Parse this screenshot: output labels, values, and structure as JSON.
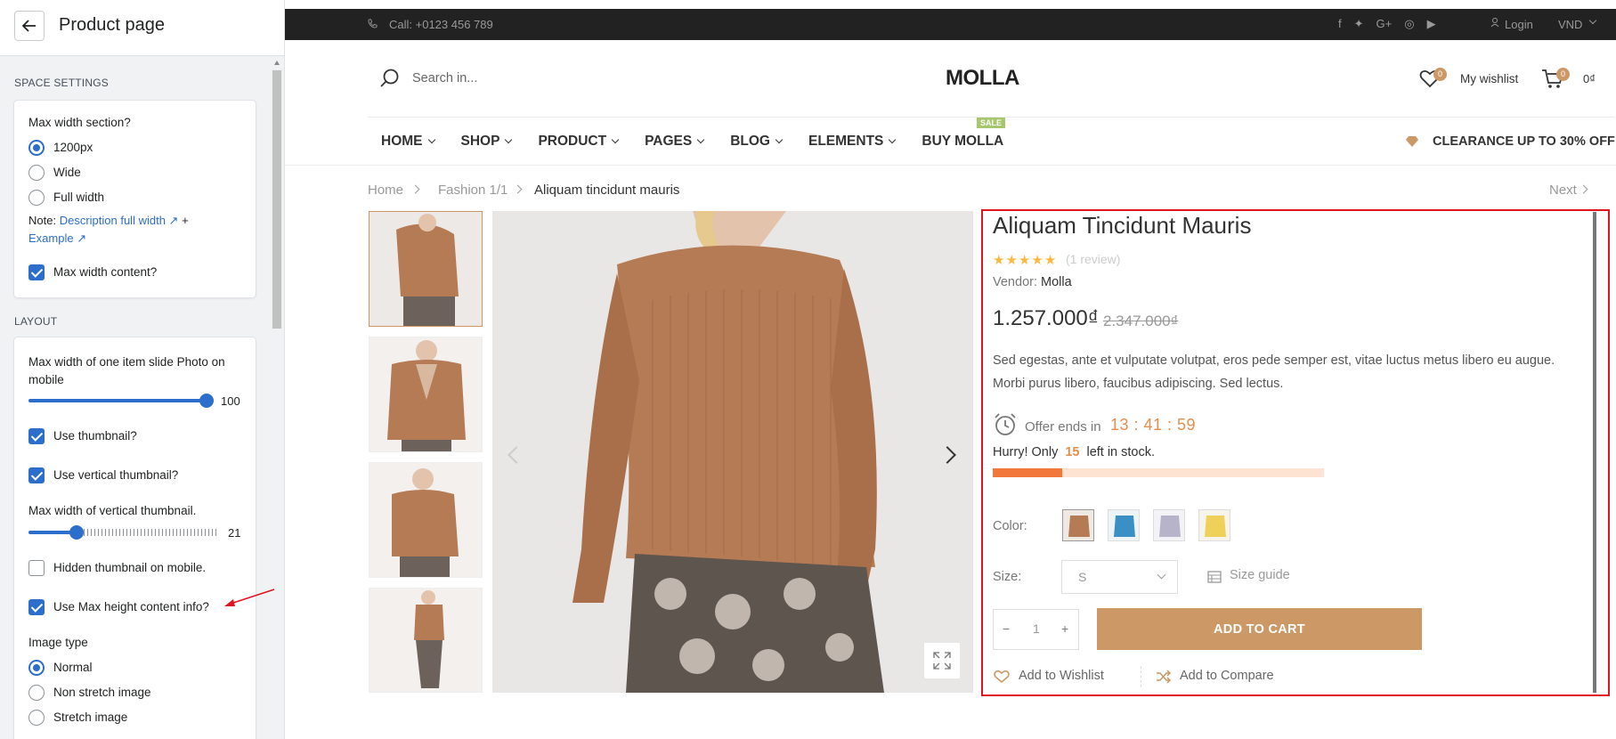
{
  "editor": {
    "title": "Product page",
    "space_settings": {
      "section_title": "SPACE SETTINGS",
      "max_width_label": "Max width section?",
      "options": [
        "1200px",
        "Wide",
        "Full width"
      ],
      "selected": "1200px",
      "note_prefix": "Note:",
      "note_link": "Description full width",
      "note_plus": "+",
      "example_link": "Example",
      "max_width_content_label": "Max width content?",
      "max_width_content_checked": true
    },
    "layout": {
      "section_title": "LAYOUT",
      "slide_label": "Max width of one item slide Photo on mobile",
      "slide_value": "100",
      "use_thumbnail_label": "Use thumbnail?",
      "use_thumbnail_checked": true,
      "use_vertical_label": "Use vertical thumbnail?",
      "use_vertical_checked": true,
      "vertical_width_label": "Max width of vertical thumbnail.",
      "vertical_width_value": "21",
      "hidden_mobile_label": "Hidden thumbnail on mobile.",
      "hidden_mobile_checked": false,
      "max_height_label": "Use Max height content info?",
      "max_height_checked": true,
      "image_type_label": "Image type",
      "image_types": [
        "Normal",
        "Non stretch image",
        "Stretch image"
      ],
      "image_type_selected": "Normal"
    }
  },
  "store": {
    "topbar": {
      "phone": "Call: +0123 456 789",
      "login": "Login",
      "currency": "VND"
    },
    "search_placeholder": "Search in...",
    "logo": "MOLLA",
    "wishlist_count": "0",
    "wishlist_label": "My wishlist",
    "cart_count": "0",
    "cart_total": "0₫",
    "nav": [
      "HOME",
      "SHOP",
      "PRODUCT",
      "PAGES",
      "BLOG",
      "ELEMENTS",
      "BUY MOLLA"
    ],
    "sale_tag": "SALE",
    "clearance": "CLEARANCE UP TO 30% OFF",
    "breadcrumb": [
      "Home",
      "Fashion 1/1",
      "Aliquam tincidunt mauris"
    ],
    "next_label": "Next",
    "product": {
      "title": "Aliquam Tincidunt Mauris",
      "rating": 5,
      "reviews": "(1 review)",
      "vendor_label": "Vendor:",
      "vendor": "Molla",
      "price": "1.257.000₫",
      "old_price": "2.347.000₫",
      "description": "Sed egestas, ante et vulputate volutpat, eros pede semper est, vitae luctus metus libero eu augue. Morbi purus libero, faucibus adipiscing. Sed lectus.",
      "offer_label": "Offer ends in",
      "timer": "13 : 41 : 59",
      "hurry_prefix": "Hurry! Only",
      "stock_qty": "15",
      "hurry_suffix": "left in stock.",
      "stock_fraction": 0.21,
      "color_label": "Color:",
      "colors": [
        "#b47b55",
        "#3a8fc5",
        "#b7b3c9",
        "#efd15a"
      ],
      "size_label": "Size:",
      "size_value": "S",
      "size_guide": "Size guide",
      "quantity": "1",
      "add_to_cart": "ADD TO CART",
      "add_wishlist": "Add to Wishlist",
      "add_compare": "Add to Compare"
    }
  },
  "colors": {
    "accent": "#cc9966",
    "link": "#2c6ecb",
    "highlight_border": "#e0141e",
    "timer": "#e78d4b"
  }
}
